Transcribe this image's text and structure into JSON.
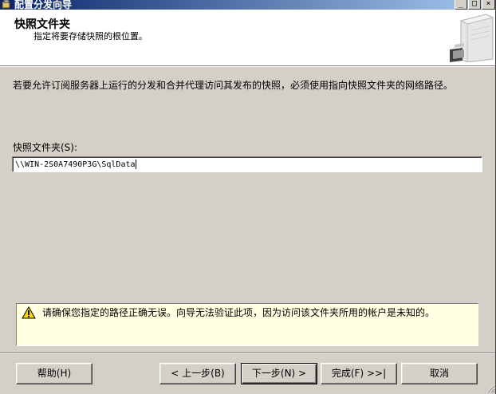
{
  "window": {
    "title": "配置分发向导",
    "minimize_glyph": "_",
    "maximize_glyph": "□",
    "close_glyph": "×"
  },
  "header": {
    "title": "快照文件夹",
    "subtitle": "指定将要存储快照的根位置。"
  },
  "body": {
    "description": "若要允许订阅服务器上运行的分发和合并代理访问其发布的快照，必须使用指向快照文件夹的网络路径。",
    "folder_label": "快照文件夹(S):",
    "folder_value": "\\\\WIN-2S0A7490P3G\\SqlData"
  },
  "warning": {
    "icon": "warning-icon",
    "text": "请确保您指定的路径正确无误。向导无法验证此项，因为访问该文件夹所用的帐户是未知的。"
  },
  "buttons": {
    "help": "帮助(H)",
    "back": "< 上一步(B)",
    "next": "下一步(N) >",
    "finish": "完成(F) >>|",
    "cancel": "取消"
  }
}
